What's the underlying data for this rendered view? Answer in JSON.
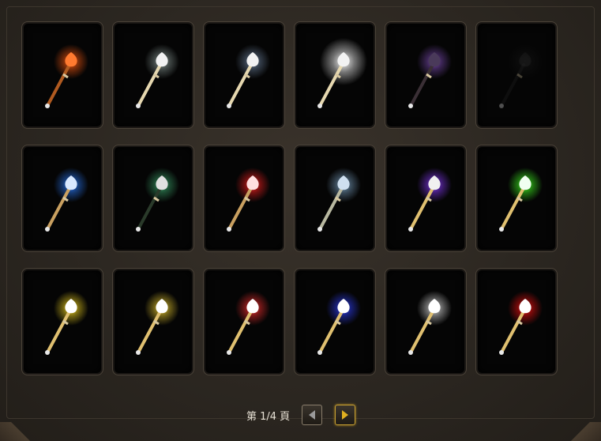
{
  "items": [
    {
      "name": "staff-item-1",
      "glow": "#ff5a10",
      "shaft": "#b05a20",
      "head": "#ff7a30",
      "variant": "flame"
    },
    {
      "name": "staff-item-2",
      "glow": "#8a9a96",
      "shaft": "#e6d8b0",
      "head": "#f2f2f2",
      "variant": "wisp"
    },
    {
      "name": "staff-item-3",
      "glow": "#6a7f9a",
      "shaft": "#e6d8b0",
      "head": "#f2f2f2",
      "variant": "dark"
    },
    {
      "name": "staff-item-4",
      "glow": "#ffffff",
      "shaft": "#e6d8b0",
      "head": "#f2f2f2",
      "variant": "white"
    },
    {
      "name": "staff-item-5",
      "glow": "#7a4ab0",
      "shaft": "#3a2f35",
      "head": "#4a3a5a",
      "variant": "shadow"
    },
    {
      "name": "staff-item-6",
      "glow": "#2a2a2a",
      "shaft": "#202020",
      "head": "#2a2a2a",
      "variant": "faded"
    },
    {
      "name": "staff-item-7",
      "glow": "#2a7cff",
      "shaft": "#c9a060",
      "head": "#d8e8ff",
      "variant": "blue"
    },
    {
      "name": "staff-item-8",
      "glow": "#3aa36a",
      "shaft": "#2a3a2a",
      "head": "#e0e0e0",
      "variant": "green-dark"
    },
    {
      "name": "staff-item-9",
      "glow": "#ff2020",
      "shaft": "#c9a060",
      "head": "#ffe0e0",
      "variant": "red"
    },
    {
      "name": "staff-item-10",
      "glow": "#7aa0c0",
      "shaft": "#b8b8a0",
      "head": "#cfe0f0",
      "variant": "ice"
    },
    {
      "name": "staff-item-11",
      "glow": "#8a3aff",
      "shaft": "#e0c070",
      "head": "#f0f0f0",
      "variant": "purple"
    },
    {
      "name": "staff-item-12",
      "glow": "#40ff20",
      "shaft": "#e0c070",
      "head": "#f0fff0",
      "variant": "lime"
    },
    {
      "name": "staff-item-13",
      "glow": "#ffe020",
      "shaft": "#e0c070",
      "head": "#ffffff",
      "variant": "gold"
    },
    {
      "name": "staff-item-14",
      "glow": "#f0d030",
      "shaft": "#e0c070",
      "head": "#ffffff",
      "variant": "gold-soft"
    },
    {
      "name": "staff-item-15",
      "glow": "#ff3030",
      "shaft": "#e0c070",
      "head": "#ffffff",
      "variant": "red-soft"
    },
    {
      "name": "staff-item-16",
      "glow": "#3040ff",
      "shaft": "#e0c070",
      "head": "#ffffff",
      "variant": "blue-soft"
    },
    {
      "name": "staff-item-17",
      "glow": "#e0e0e0",
      "shaft": "#e0c070",
      "head": "#ffffff",
      "variant": "white-soft"
    },
    {
      "name": "staff-item-18",
      "glow": "#ff1010",
      "shaft": "#e0c070",
      "head": "#ffffff",
      "variant": "crimson"
    }
  ],
  "pagination": {
    "label": "第 1/4 頁",
    "prev_icon": "arrow-left-icon",
    "next_icon": "arrow-right-icon",
    "next_color": "#e0b020",
    "prev_color": "#9a9a9a"
  }
}
